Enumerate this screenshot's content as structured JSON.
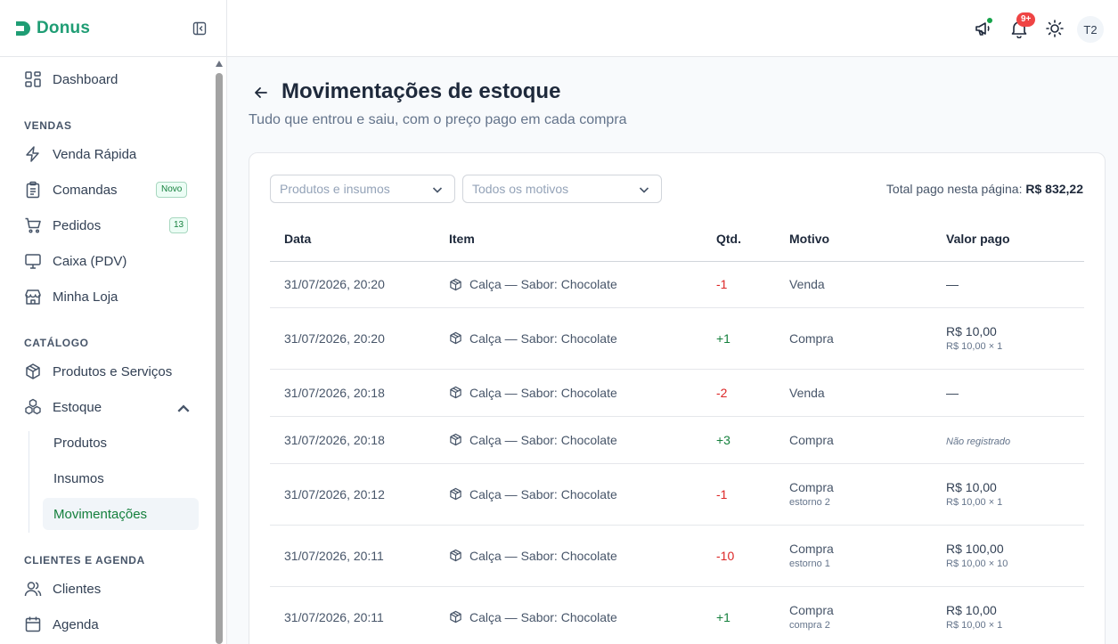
{
  "brand": {
    "name": "Donus"
  },
  "sidebar": {
    "dashboard": "Dashboard",
    "sections": {
      "vendas": "VENDAS",
      "catalogo": "CATÁLOGO",
      "clientes": "CLIENTES E AGENDA"
    },
    "venda_rapida": "Venda Rápida",
    "comandas": "Comandas",
    "comandas_badge": "Novo",
    "pedidos": "Pedidos",
    "pedidos_badge": "13",
    "caixa": "Caixa (PDV)",
    "minha_loja": "Minha Loja",
    "produtos_servicos": "Produtos e Serviços",
    "estoque": "Estoque",
    "estoque_sub": {
      "produtos": "Produtos",
      "insumos": "Insumos",
      "movimentacoes": "Movimentações"
    },
    "clientes": "Clientes",
    "agenda": "Agenda"
  },
  "topbar": {
    "notifications_badge": "9+",
    "avatar": "T2"
  },
  "page": {
    "title": "Movimentações de estoque",
    "subtitle": "Tudo que entrou e saiu, com o preço pago em cada compra"
  },
  "filters": {
    "type": "Produtos e insumos",
    "reason": "Todos os motivos",
    "total_label": "Total pago nesta página:",
    "total_value": "R$ 832,22"
  },
  "table": {
    "headers": {
      "date": "Data",
      "item": "Item",
      "qty": "Qtd.",
      "reason": "Motivo",
      "paid": "Valor pago"
    },
    "rows": [
      {
        "date": "31/07/2026, 20:20",
        "item": "Calça — Sabor: Chocolate",
        "qty": "-1",
        "reason": "Venda",
        "reason_sub": "",
        "paid": "—",
        "paid_sub": ""
      },
      {
        "date": "31/07/2026, 20:20",
        "item": "Calça — Sabor: Chocolate",
        "qty": "+1",
        "reason": "Compra",
        "reason_sub": "",
        "paid": "R$ 10,00",
        "paid_sub": "R$ 10,00 × 1"
      },
      {
        "date": "31/07/2026, 20:18",
        "item": "Calça — Sabor: Chocolate",
        "qty": "-2",
        "reason": "Venda",
        "reason_sub": "",
        "paid": "—",
        "paid_sub": ""
      },
      {
        "date": "31/07/2026, 20:18",
        "item": "Calça — Sabor: Chocolate",
        "qty": "+3",
        "reason": "Compra",
        "reason_sub": "",
        "paid": "Não registrado",
        "paid_sub": ""
      },
      {
        "date": "31/07/2026, 20:12",
        "item": "Calça — Sabor: Chocolate",
        "qty": "-1",
        "reason": "Compra",
        "reason_sub": "estorno 2",
        "paid": "R$ 10,00",
        "paid_sub": "R$ 10,00 × 1"
      },
      {
        "date": "31/07/2026, 20:11",
        "item": "Calça — Sabor: Chocolate",
        "qty": "-10",
        "reason": "Compra",
        "reason_sub": "estorno 1",
        "paid": "R$ 100,00",
        "paid_sub": "R$ 10,00 × 10"
      },
      {
        "date": "31/07/2026, 20:11",
        "item": "Calça — Sabor: Chocolate",
        "qty": "+1",
        "reason": "Compra",
        "reason_sub": "compra 2",
        "paid": "R$ 10,00",
        "paid_sub": "R$ 10,00 × 1"
      }
    ]
  }
}
